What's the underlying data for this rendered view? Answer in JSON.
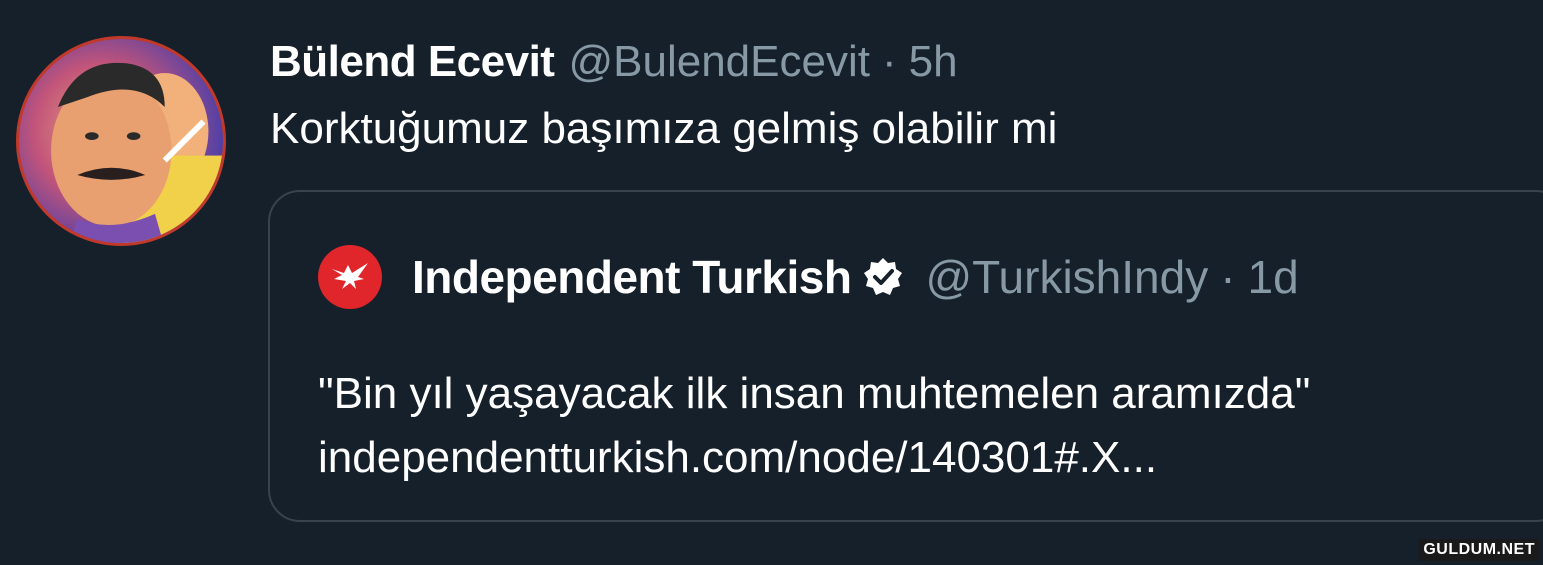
{
  "tweet": {
    "display_name": "Bülend Ecevit",
    "handle": "@BulendEcevit",
    "separator": "·",
    "time": "5h",
    "text": "Korktuğumuz başımıza gelmiş olabilir mi",
    "avatar_icon": "profile-avatar"
  },
  "quoted_tweet": {
    "display_name": "Independent Turkish",
    "verified_icon": "verified-badge-icon",
    "logo_icon": "eagle-logo-icon",
    "handle": "@TurkishIndy",
    "separator": "·",
    "time": "1d",
    "text_line_1": "\"Bin yıl yaşayacak ilk insan muhtemelen aramızda\"",
    "text_line_2": "independentturkish.com/node/140301#.X..."
  },
  "watermark": "GULDUM.NET",
  "colors": {
    "background": "#15202b",
    "primary_text": "#ffffff",
    "secondary_text": "#8899a6",
    "card_border": "#38444d",
    "logo_red": "#e0262b"
  }
}
